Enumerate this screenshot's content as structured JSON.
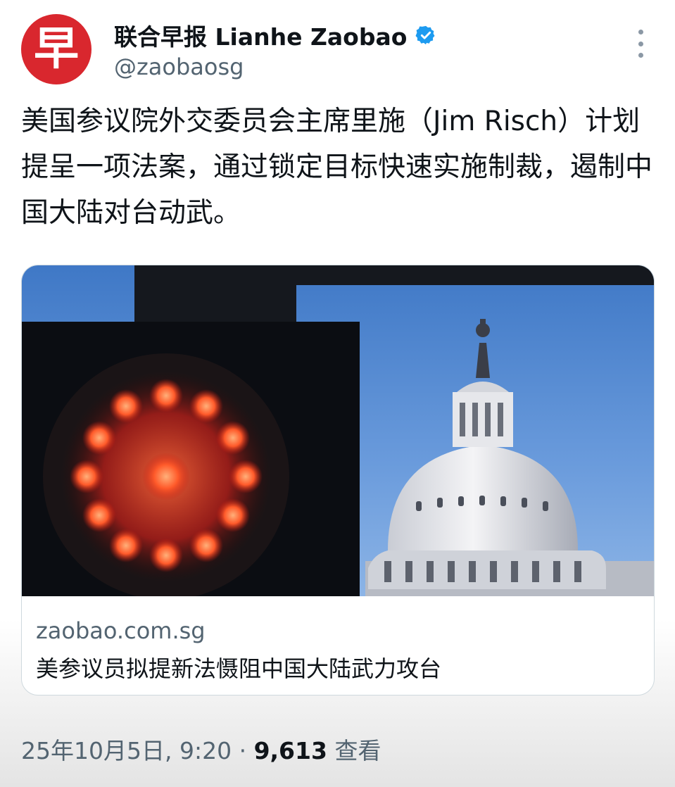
{
  "account": {
    "avatar_char": "早",
    "display_name": "联合早报 Lianhe Zaobao",
    "handle": "@zaobaosg",
    "verified": true
  },
  "tweet": {
    "text": "美国参议院外交委员会主席里施（Jim Risch）计划提呈一项法案，通过锁定目标快速实施制裁，遏制中国大陆对台动武。"
  },
  "card": {
    "domain": "zaobao.com.sg",
    "title": "美参议员拟提新法慑阻中国大陆武力攻台"
  },
  "meta": {
    "timestamp": "25年10月5日, 9:20",
    "separator": "·",
    "views_count": "9,613",
    "views_label": "查看"
  },
  "colors": {
    "brand_red": "#d9272e",
    "verified_blue": "#1d9bf0",
    "secondary_text": "#536471"
  }
}
